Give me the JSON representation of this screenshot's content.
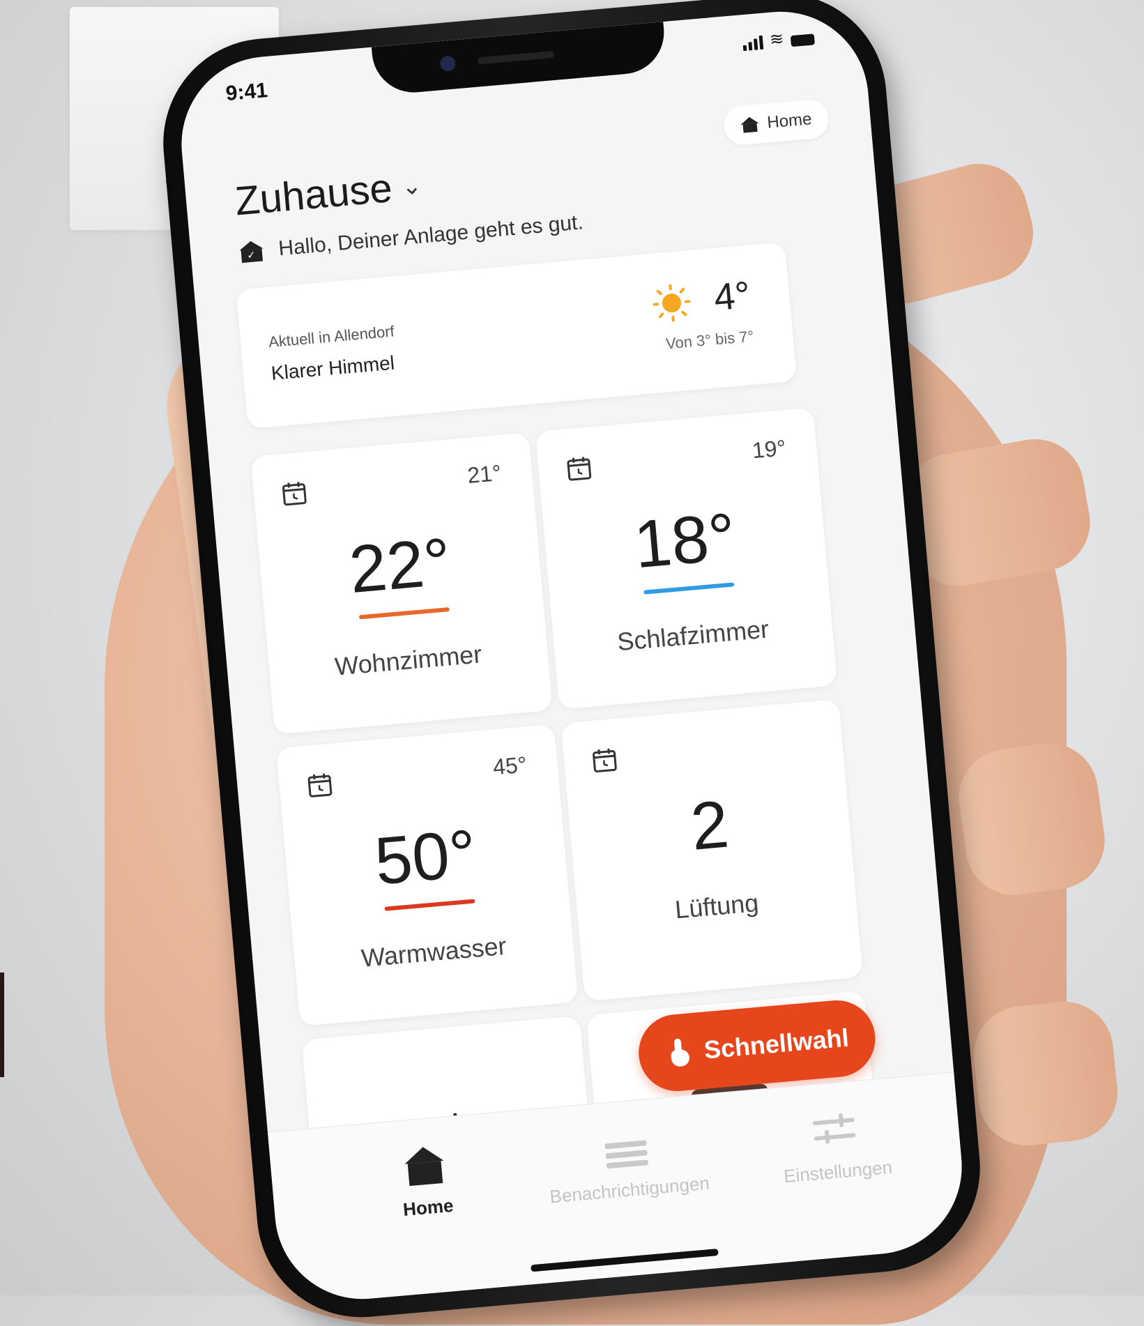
{
  "status_bar": {
    "time": "9:41"
  },
  "header": {
    "title": "Zuhause",
    "home_chip": "Home",
    "greeting": "Hallo, Deiner Anlage geht es gut."
  },
  "weather": {
    "location_label": "Aktuell in Allendorf",
    "condition": "Klarer Himmel",
    "temperature": "4°",
    "range": "Von 3° bis 7°"
  },
  "tiles": [
    {
      "name": "Wohnzimmer",
      "value": "22°",
      "setpoint": "21°",
      "accent": "#e8672c"
    },
    {
      "name": "Schlafzimmer",
      "value": "18°",
      "setpoint": "19°",
      "accent": "#2f9be3"
    },
    {
      "name": "Warmwasser",
      "value": "50°",
      "setpoint": "45°",
      "accent": "#d9391f"
    },
    {
      "name": "Lüftung",
      "value": "2"
    }
  ],
  "quick_select": {
    "label": "Schnellwahl",
    "color": "#e5461c"
  },
  "tabbar": {
    "home": "Home",
    "notifications": "Benachrichtigungen",
    "settings": "Einstellungen"
  }
}
